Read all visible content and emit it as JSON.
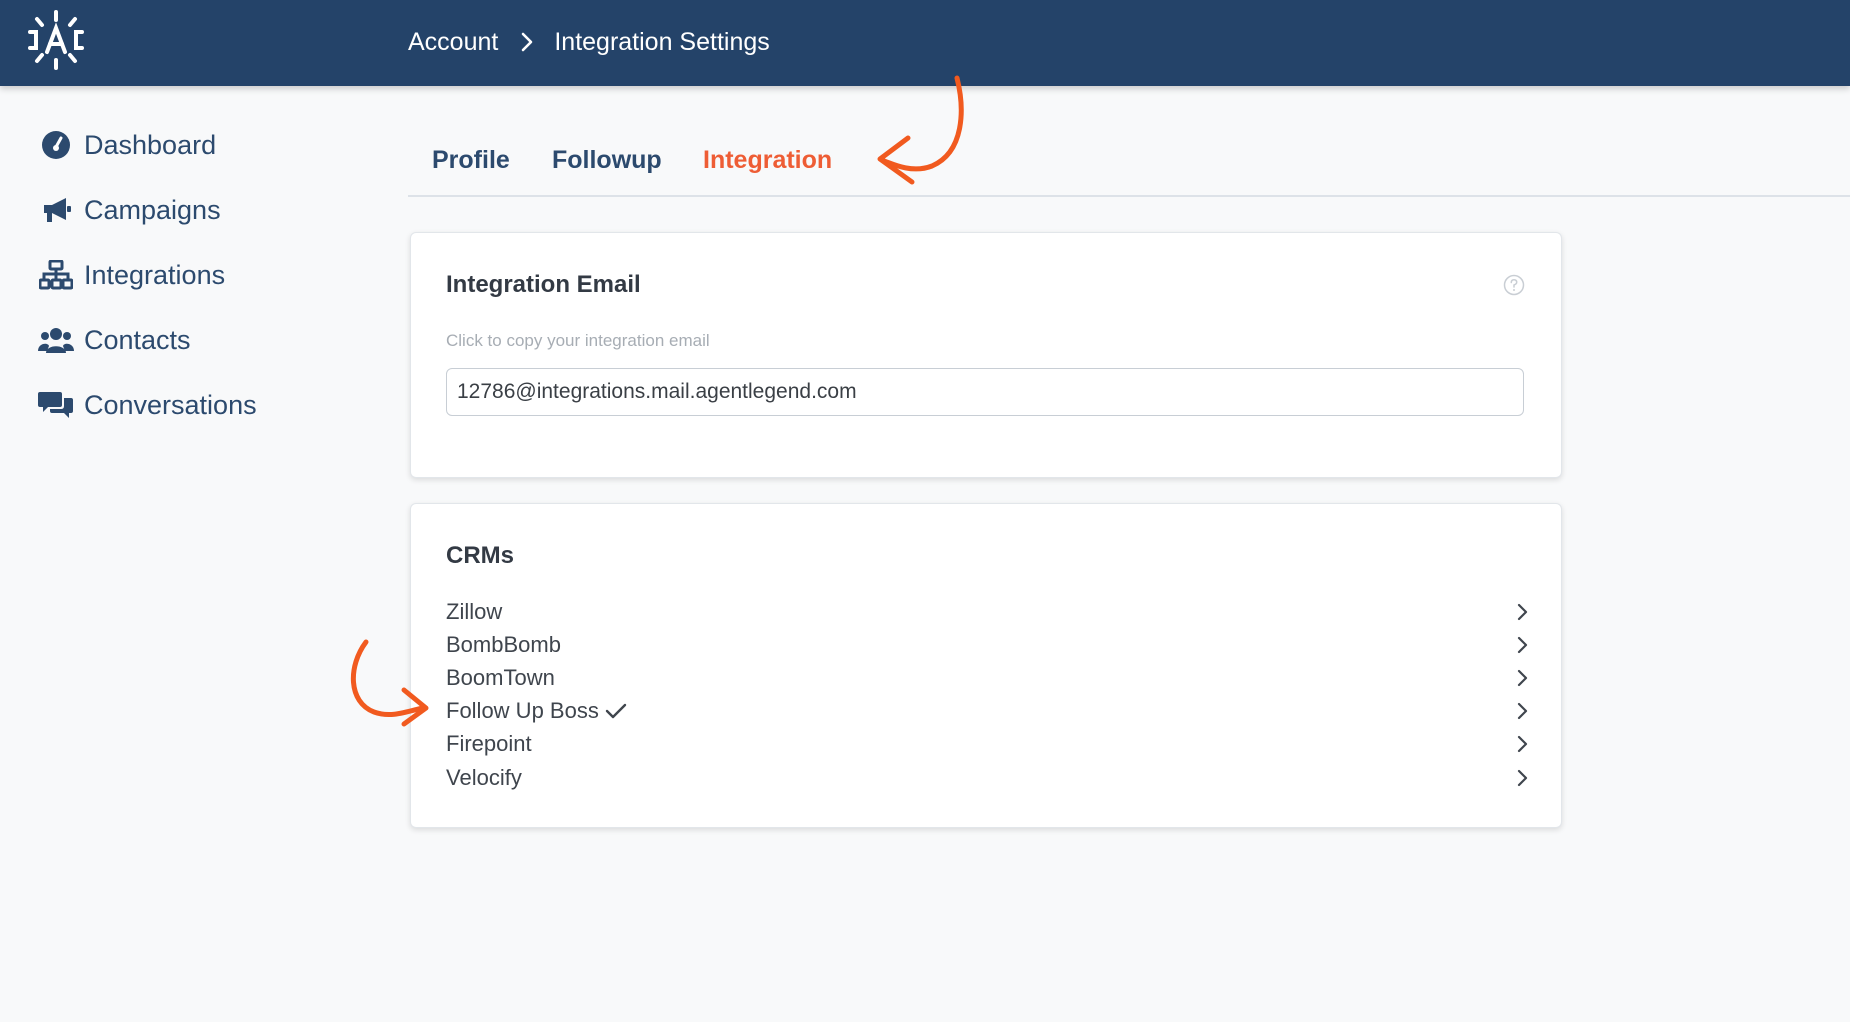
{
  "breadcrumb": {
    "parent": "Account",
    "current": "Integration Settings"
  },
  "sidebar": {
    "items": [
      {
        "label": "Dashboard",
        "icon": "gauge-icon"
      },
      {
        "label": "Campaigns",
        "icon": "megaphone-icon"
      },
      {
        "label": "Integrations",
        "icon": "sitemap-icon"
      },
      {
        "label": "Contacts",
        "icon": "users-icon"
      },
      {
        "label": "Conversations",
        "icon": "chat-bubbles-icon"
      }
    ]
  },
  "tabs": {
    "items": [
      {
        "label": "Profile"
      },
      {
        "label": "Followup"
      },
      {
        "label": "Integration"
      }
    ],
    "active": "Integration"
  },
  "integration_email": {
    "title": "Integration Email",
    "hint": "Click to copy your integration email",
    "value": "12786@integrations.mail.agentlegend.com"
  },
  "crms": {
    "title": "CRMs",
    "items": [
      {
        "name": "Zillow",
        "connected": false
      },
      {
        "name": "BombBomb",
        "connected": false
      },
      {
        "name": "BoomTown",
        "connected": false
      },
      {
        "name": "Follow Up Boss",
        "connected": true
      },
      {
        "name": "Firepoint",
        "connected": false
      },
      {
        "name": "Velocify",
        "connected": false
      }
    ]
  },
  "colors": {
    "header_bg": "#244369",
    "nav_text": "#2c4a6e",
    "active_tab": "#ee5d35",
    "annotation": "#f15a1f"
  }
}
